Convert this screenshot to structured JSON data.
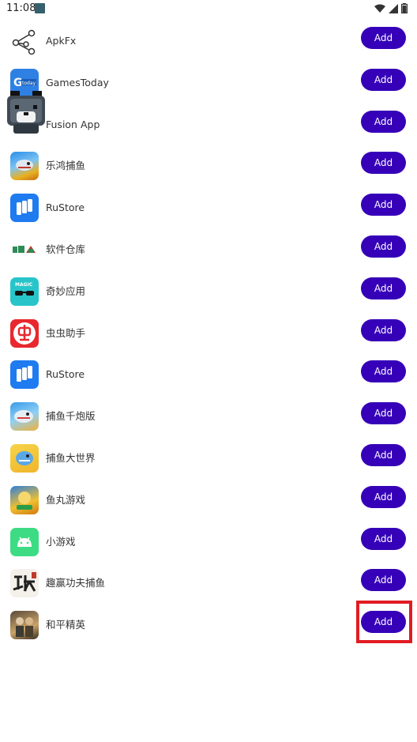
{
  "status_bar": {
    "time": "11:08",
    "icons": [
      "app-notification-icon",
      "wifi-icon",
      "signal-icon",
      "battery-icon"
    ]
  },
  "button_color": "#3600b9",
  "highlight_color": "#e01c22",
  "apps": [
    {
      "label": "ApkFx",
      "icon": "share-nodes-icon",
      "button": "Add"
    },
    {
      "label": "GamesToday",
      "icon": "gamestoday-icon",
      "button": "Add"
    },
    {
      "label": "Fusion App",
      "icon": "fusion-app-icon",
      "button": "Add"
    },
    {
      "label": "乐鸿捕鱼",
      "icon": "fish-game-icon",
      "button": "Add"
    },
    {
      "label": "RuStore",
      "icon": "rustore-icon",
      "button": "Add"
    },
    {
      "label": "软件仓库",
      "icon": "software-store-icon",
      "button": "Add"
    },
    {
      "label": "奇妙应用",
      "icon": "magic-app-icon",
      "button": "Add"
    },
    {
      "label": "虫虫助手",
      "icon": "chongchong-icon",
      "button": "Add"
    },
    {
      "label": "RuStore",
      "icon": "rustore-icon",
      "button": "Add"
    },
    {
      "label": "捕鱼千炮版",
      "icon": "shark-game-icon",
      "button": "Add"
    },
    {
      "label": "捕鱼大世界",
      "icon": "shark-world-icon",
      "button": "Add"
    },
    {
      "label": "鱼丸游戏",
      "icon": "fishball-game-icon",
      "button": "Add"
    },
    {
      "label": "小游戏",
      "icon": "android-icon",
      "button": "Add"
    },
    {
      "label": "趣赢功夫捕鱼",
      "icon": "kungfu-fish-icon",
      "button": "Add"
    },
    {
      "label": "和平精英",
      "icon": "peace-elite-icon",
      "button": "Add"
    }
  ]
}
